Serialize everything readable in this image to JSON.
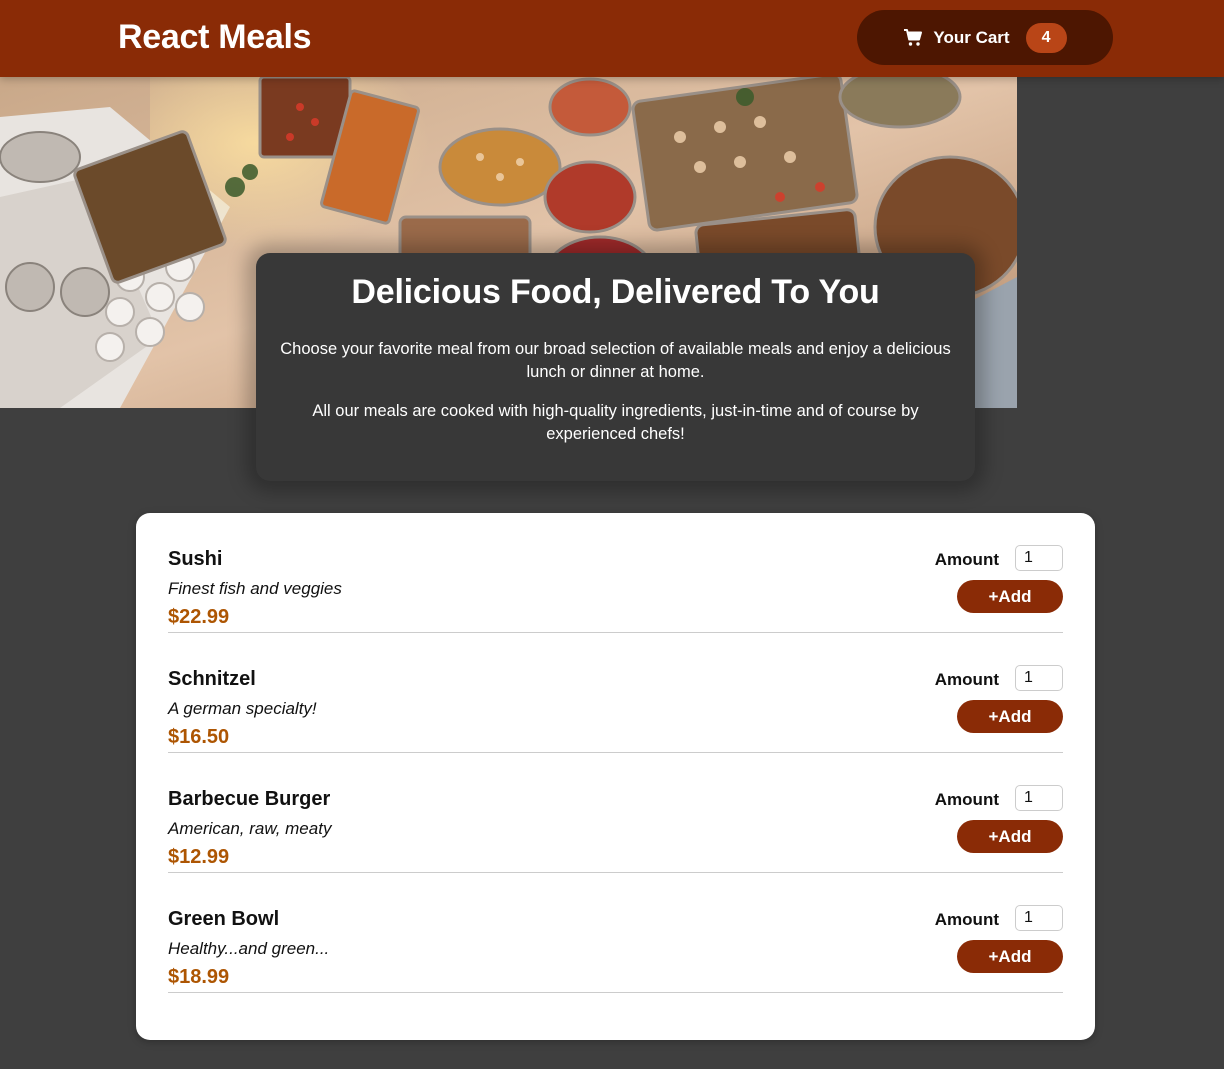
{
  "header": {
    "title": "React Meals",
    "cart_label": "Your Cart",
    "cart_count": "4",
    "cart_icon": "cart-icon"
  },
  "hero": {
    "image_alt": "A table full of delicious food!"
  },
  "summary": {
    "heading": "Delicious Food, Delivered To You",
    "paragraph1": "Choose your favorite meal from our broad selection of available meals and enjoy a delicious lunch or dinner at home.",
    "paragraph2": "All our meals are cooked with high-quality ingredients, just-in-time and of course by experienced chefs!"
  },
  "meals": [
    {
      "name": "Sushi",
      "description": "Finest fish and veggies",
      "price": "$22.99",
      "amount_label": "Amount",
      "amount_value": "1",
      "add_label": "+Add"
    },
    {
      "name": "Schnitzel",
      "description": "A german specialty!",
      "price": "$16.50",
      "amount_label": "Amount",
      "amount_value": "1",
      "add_label": "+Add"
    },
    {
      "name": "Barbecue Burger",
      "description": "American, raw, meaty",
      "price": "$12.99",
      "amount_label": "Amount",
      "amount_value": "1",
      "add_label": "+Add"
    },
    {
      "name": "Green Bowl",
      "description": "Healthy...and green...",
      "price": "$18.99",
      "amount_label": "Amount",
      "amount_value": "1",
      "add_label": "+Add"
    }
  ],
  "colors": {
    "header_bg": "#8a2b06",
    "cart_button_bg": "#4d1601",
    "cart_badge_bg": "#b94517",
    "page_bg": "#3f3f3f",
    "price": "#ad5502"
  }
}
